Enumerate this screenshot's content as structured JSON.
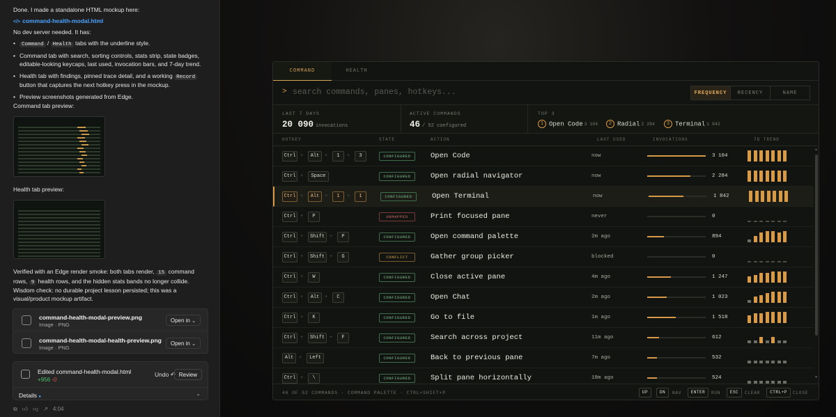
{
  "chat": {
    "done_text": "Done. I made a standalone HTML mockup here:",
    "file_link": "command-health-modal.html",
    "file_link_icon": "</>",
    "no_dev": "No dev server needed. It has:",
    "b1_code1": "Command",
    "b1_slash": "/",
    "b1_code2": "Health",
    "b1_text": "tabs with the underline style.",
    "b2": "Command tab with search, sorting controls, stats strip, state badges, editable-looking keycaps, last used, invocation bars, and 7-day trend.",
    "b3_a": "Health tab with findings, pinned trace detail, and a working",
    "b3_code": "Record",
    "b3_b": "button that captures the next hotkey press in the mockup.",
    "b4": "Preview screenshots generated from Edge.",
    "cmd_preview_label": "Command tab preview:",
    "health_preview_label": "Health tab preview:",
    "verify_a": "Verified with an Edge render smoke: both tabs render,",
    "verify_code1": "15",
    "verify_b": "command rows,",
    "verify_code2": "9",
    "verify_c": "health rows, and the hidden stats bands no longer collide.",
    "wisdom": "Wisdom check: no durable project lesson persisted; this was a visual/product mockup artifact.",
    "attachments": [
      {
        "name": "command-health-modal-preview.png",
        "sub": "Image · PNG",
        "open": "Open in"
      },
      {
        "name": "command-health-modal-health-preview.png",
        "sub": "Image · PNG",
        "open": "Open in"
      }
    ],
    "edited": {
      "title": "Edited command-health-modal.html",
      "add": "+956",
      "del": "-0",
      "undo": "Undo",
      "review": "Review",
      "details": "Details"
    },
    "time": "4:04"
  },
  "modal": {
    "tabs": [
      "COMMAND",
      "HEALTH"
    ],
    "search_prompt": ">",
    "search_placeholder": "search commands, panes, hotkeys...",
    "sort": [
      "FREQUENCY",
      "RECENCY",
      "NAME"
    ],
    "stats": {
      "last7_label": "LAST 7 DAYS",
      "last7_value": "20 090",
      "last7_unit": "invocations",
      "active_label": "ACTIVE COMMANDS",
      "active_value": "46",
      "active_unit": "/ 52 configured",
      "top_label": "TOP 3",
      "top": [
        {
          "rank": "1",
          "name": "Open Code",
          "count": "3 104"
        },
        {
          "rank": "2",
          "name": "Radial",
          "count": "2 284"
        },
        {
          "rank": "3",
          "name": "Terminal",
          "count": "1 842"
        }
      ]
    },
    "headers": {
      "hotkey": "HOTKEY",
      "state": "STATE",
      "action": "ACTION",
      "last_used": "LAST USED",
      "invocations": "INVOCATIONS",
      "trend": "7D TREND"
    },
    "rows": [
      {
        "keys": [
          "Ctrl",
          "Alt",
          "1",
          "3"
        ],
        "state": "CONFIGURED",
        "action": "Open Code",
        "last": "now",
        "inv": "3 104",
        "frac": 1.0,
        "trend": [
          5,
          5,
          5,
          5,
          5,
          5,
          5
        ]
      },
      {
        "keys": [
          "Ctrl",
          "Space"
        ],
        "state": "CONFIGURED",
        "action": "Open radial navigator",
        "last": "now",
        "inv": "2 284",
        "frac": 0.74,
        "trend": [
          5,
          5,
          5,
          5,
          5,
          5,
          5
        ]
      },
      {
        "keys": [
          "Ctrl",
          "Alt",
          "1",
          "1"
        ],
        "state": "CONFIGURED",
        "action": "Open Terminal",
        "last": "now",
        "inv": "1 842",
        "frac": 0.6,
        "trend": [
          5,
          5,
          5,
          5,
          5,
          5,
          5
        ],
        "selected": true
      },
      {
        "keys": [
          "Ctrl",
          "P"
        ],
        "state": "UNMAPPED",
        "action": "Print focused pane",
        "last": "never",
        "inv": "0",
        "frac": 0,
        "trend": [
          0,
          0,
          0,
          0,
          0,
          0,
          0
        ]
      },
      {
        "keys": [
          "Ctrl",
          "Shift",
          "P"
        ],
        "state": "CONFIGURED",
        "action": "Open command palette",
        "last": "2m ago",
        "inv": "894",
        "frac": 0.29,
        "trend": [
          1,
          2,
          4,
          5,
          5,
          4,
          5
        ]
      },
      {
        "keys": [
          "Ctrl",
          "Shift",
          "G"
        ],
        "state": "CONFLICT",
        "action": "Gather group picker",
        "last": "blocked",
        "inv": "0",
        "frac": 0,
        "trend": [
          0,
          0,
          0,
          0,
          0,
          0,
          0
        ]
      },
      {
        "keys": [
          "Ctrl",
          "W"
        ],
        "state": "CONFIGURED",
        "action": "Close active pane",
        "last": "4m ago",
        "inv": "1 247",
        "frac": 0.4,
        "trend": [
          2,
          3,
          4,
          4,
          5,
          5,
          5
        ]
      },
      {
        "keys": [
          "Ctrl",
          "Alt",
          "C"
        ],
        "state": "CONFIGURED",
        "action": "Open Chat",
        "last": "2m ago",
        "inv": "1 023",
        "frac": 0.33,
        "trend": [
          1,
          2,
          3,
          4,
          5,
          5,
          5
        ]
      },
      {
        "keys": [
          "Ctrl",
          "K"
        ],
        "state": "CONFIGURED",
        "action": "Go to file",
        "last": "1m ago",
        "inv": "1 518",
        "frac": 0.49,
        "trend": [
          3,
          4,
          4,
          5,
          5,
          5,
          5
        ]
      },
      {
        "keys": [
          "Ctrl",
          "Shift",
          "F"
        ],
        "state": "CONFIGURED",
        "action": "Search across project",
        "last": "11m ago",
        "inv": "612",
        "frac": 0.2,
        "trend": [
          1,
          1,
          2,
          1,
          2,
          1,
          1
        ]
      },
      {
        "keys": [
          "Alt",
          "Left"
        ],
        "state": "CONFIGURED",
        "action": "Back to previous pane",
        "last": "7m ago",
        "inv": "532",
        "frac": 0.17,
        "trend": [
          1,
          1,
          1,
          1,
          1,
          1,
          1
        ]
      },
      {
        "keys": [
          "Ctrl",
          "\\"
        ],
        "state": "CONFIGURED",
        "action": "Split pane horizontally",
        "last": "18m ago",
        "inv": "524",
        "frac": 0.17,
        "trend": [
          1,
          1,
          1,
          1,
          1,
          1,
          1
        ]
      }
    ],
    "footer": "46 OF 52 COMMANDS · COMMAND PALETTE · CTRL+SHIFT+P",
    "keyhints": [
      {
        "key": "UP",
        "label": ""
      },
      {
        "key": "DN",
        "label": "NAV"
      },
      {
        "key": "ENTER",
        "label": "RUN"
      },
      {
        "key": "ESC",
        "label": "CLEAR"
      },
      {
        "key": "CTRL+P",
        "label": "CLOSE"
      }
    ]
  },
  "colors": {
    "accent": "#d99a45",
    "configured": "#7fc48e",
    "unmapped": "#d46a6a",
    "conflict": "#e0a652"
  }
}
